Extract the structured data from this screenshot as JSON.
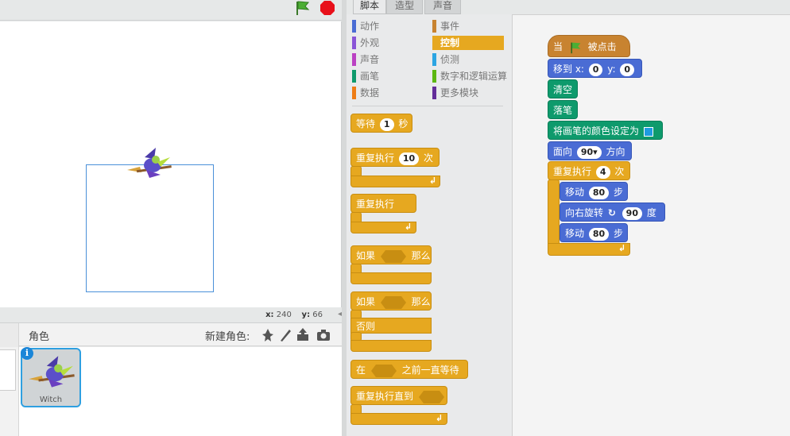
{
  "stage": {
    "coord_x_label": "x:",
    "coord_x_value": "240",
    "coord_y_label": "y:",
    "coord_y_value": "66"
  },
  "sprites": {
    "title": "角色",
    "new_sprite_label": "新建角色:",
    "selected_sprite_name": "Witch",
    "info": "i"
  },
  "tabs": [
    "脚本",
    "造型",
    "声音"
  ],
  "categories": {
    "left": [
      {
        "label": "动作",
        "color": "#4a6cd4"
      },
      {
        "label": "外观",
        "color": "#8a55d7"
      },
      {
        "label": "声音",
        "color": "#bb42c3"
      },
      {
        "label": "画笔",
        "color": "#0e9a6c"
      },
      {
        "label": "数据",
        "color": "#ee7d16"
      }
    ],
    "right": [
      {
        "label": "事件",
        "color": "#c88330"
      },
      {
        "label": "控制",
        "color": "#e6a820"
      },
      {
        "label": "侦测",
        "color": "#2ca5e2"
      },
      {
        "label": "数字和逻辑运算",
        "color": "#5cb712"
      },
      {
        "label": "更多模块",
        "color": "#632d99"
      }
    ]
  },
  "palette_blocks": {
    "wait": {
      "label": "等待",
      "value": "1",
      "unit": "秒"
    },
    "repeat": {
      "label": "重复执行",
      "value": "10",
      "unit": "次"
    },
    "forever": {
      "label": "重复执行"
    },
    "if_then": {
      "label": "如果",
      "then": "那么"
    },
    "if_else": {
      "label": "如果",
      "then": "那么",
      "else": "否则"
    },
    "wait_until": {
      "label": "在",
      "suffix": "之前一直等待"
    },
    "repeat_until": {
      "label": "重复执行直到"
    }
  },
  "script": {
    "hat": {
      "prefix": "当",
      "suffix": "被点击"
    },
    "goto": {
      "label": "移到 x:",
      "x": "0",
      "ylabel": "y:",
      "y": "0"
    },
    "clear": {
      "label": "清空"
    },
    "pen_down": {
      "label": "落笔"
    },
    "set_color": {
      "label": "将画笔的颜色设定为",
      "color": "#1e9be0"
    },
    "point_dir": {
      "label": "面向",
      "value": "90▾",
      "suffix": "方向"
    },
    "repeat": {
      "label": "重复执行",
      "value": "4",
      "unit": "次"
    },
    "move1": {
      "label": "移动",
      "value": "80",
      "unit": "步"
    },
    "turn": {
      "label": "向右旋转",
      "value": "90",
      "unit": "度"
    },
    "move2": {
      "label": "移动",
      "value": "80",
      "unit": "步"
    }
  }
}
